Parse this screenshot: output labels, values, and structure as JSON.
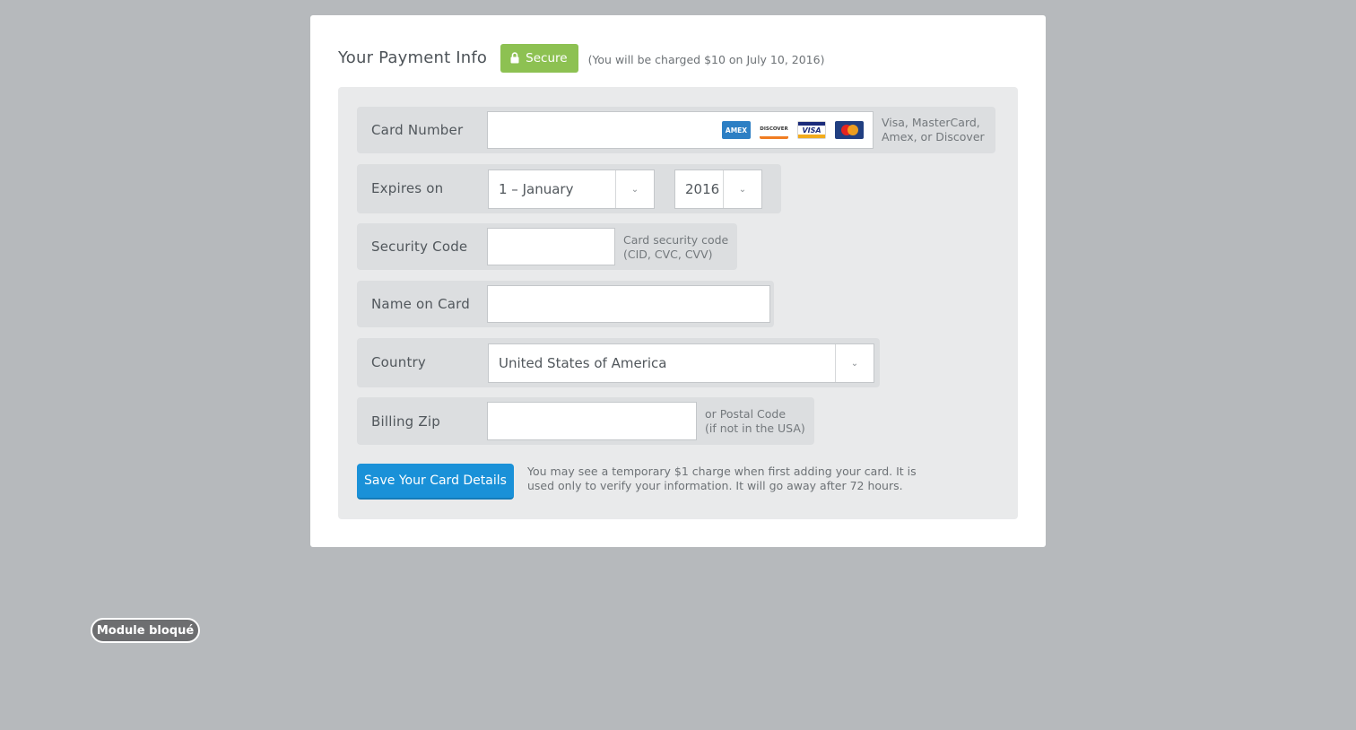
{
  "header": {
    "title": "Your Payment Info",
    "secure_label": "Secure",
    "charge_note": "(You will be charged $10 on July 10, 2016)"
  },
  "form": {
    "card_number": {
      "label": "Card Number",
      "value": "",
      "logos": [
        "AMEX",
        "DISCOVER",
        "VISA",
        "MasterCard"
      ],
      "hint_line1": "Visa, MasterCard,",
      "hint_line2": "Amex, or Discover"
    },
    "expires": {
      "label": "Expires on",
      "month_value": "1 – January",
      "year_value": "2016"
    },
    "security_code": {
      "label": "Security Code",
      "value": "",
      "hint_line1": "Card security code",
      "hint_line2": "(CID, CVC, CVV)"
    },
    "name_on_card": {
      "label": "Name on Card",
      "value": ""
    },
    "country": {
      "label": "Country",
      "value": "United States of America"
    },
    "billing_zip": {
      "label": "Billing Zip",
      "value": "",
      "hint_line1": "or Postal Code",
      "hint_line2": "(if not in the USA)"
    },
    "save_button": "Save Your Card Details",
    "save_note": "You may see a temporary $1 charge when first adding your card. It is used only to verify your information. It will go away after 72 hours."
  },
  "module_badge": "Module bloqué",
  "colors": {
    "background": "#b6b9bc",
    "secure_green": "#8dc152",
    "primary_blue": "#1a91d8"
  }
}
